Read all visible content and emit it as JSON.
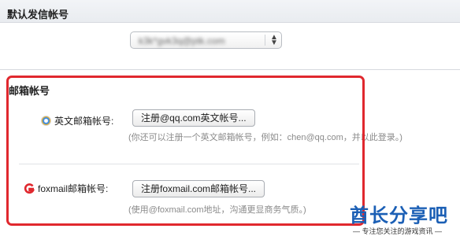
{
  "default_sender": {
    "title": "默认发信帐号",
    "select_value": "k3k*gvk3q@ptk.com"
  },
  "mail_accounts": {
    "title": "邮箱帐号",
    "english": {
      "label": "英文邮箱帐号:",
      "button": "注册@qq.com英文帐号...",
      "hint": "(你还可以注册一个英文邮箱帐号，例如：chen@qq.com，并以此登录。)"
    },
    "foxmail": {
      "label": "foxmail邮箱帐号:",
      "button": "注册foxmail.com邮箱帐号...",
      "hint": "(使用@foxmail.com地址，沟通更显商务气质。)"
    }
  },
  "watermark": {
    "title": "酋长分享吧",
    "subtitle": "— 专注您关注的游戏资讯 —"
  },
  "colors": {
    "highlight_border": "#e0282e",
    "watermark": "#1b5fb5"
  }
}
